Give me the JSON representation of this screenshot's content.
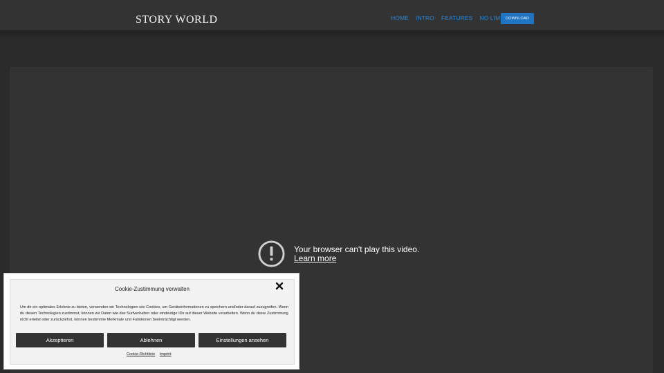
{
  "header": {
    "logo_text": "Story World",
    "nav": [
      {
        "label": "HOME"
      },
      {
        "label": "INTRO"
      },
      {
        "label": "FEATURES"
      },
      {
        "label": "NO LIMITS"
      }
    ],
    "download_label": "DOWNLOAD"
  },
  "video": {
    "error_line1": "Your browser can't play this video.",
    "error_line2": "Learn more"
  },
  "cookie": {
    "title": "Cookie-Zustimmung verwalten",
    "body": "Um dir ein optimales Erlebnis zu bieten, verwenden wir Technologien wie Cookies, um Geräteinformationen zu speichern und/oder darauf zuzugreifen. Wenn du diesen Technologien zustimmst, können wir Daten wie das Surfverhalten oder eindeutige IDs auf dieser Website verarbeiten. Wenn du deine Zustimmung nicht erteilst oder zurückziehst, können bestimmte Merkmale und Funktionen beeinträchtigt werden.",
    "accept_label": "Akzeptieren",
    "deny_label": "Ablehnen",
    "settings_label": "Einstellungen ansehen",
    "link_policy": "Cookie-Richtlinie",
    "link_imprint": "Imprint"
  },
  "colors": {
    "accent": "#1f74c4",
    "nav_link": "#2f86d2",
    "button_dark": "#333333"
  }
}
